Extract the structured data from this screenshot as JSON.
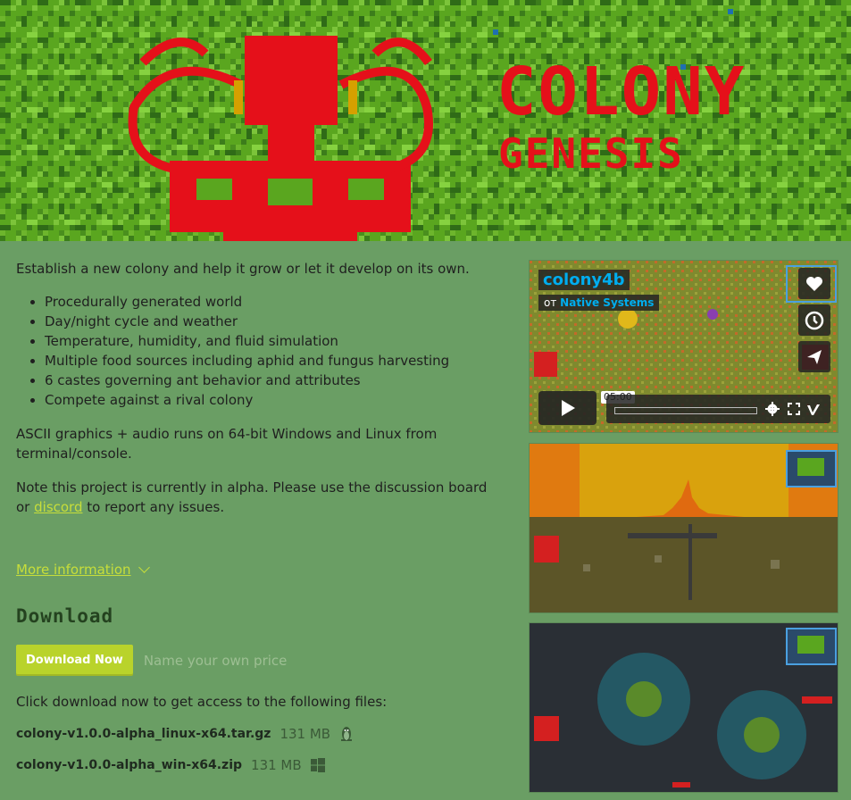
{
  "banner": {
    "title_line1": "COLONY",
    "title_line2": "GENESIS",
    "colors": {
      "grass": "#5aa61f",
      "grass_dark": "#3c7d1b",
      "ant": "#e5101a",
      "accent": "#d6a000"
    }
  },
  "description": {
    "intro": "Establish a new colony and help it grow or let it develop on its own.",
    "features": [
      "Procedurally generated world",
      "Day/night cycle and weather",
      "Temperature, humidity, and fluid simulation",
      "Multiple food sources including aphid and fungus harvesting",
      "6 castes governing ant behavior and attributes",
      "Compete against a rival colony"
    ],
    "platforms": "ASCII graphics + audio runs on 64-bit Windows and Linux from terminal/console.",
    "alpha_note_before": "Note this project is currently in alpha. Please use the discussion board or ",
    "alpha_note_link": "discord",
    "alpha_note_after": " to report any issues.",
    "more_info": "More information"
  },
  "download": {
    "heading": "Download",
    "button_label": "Download Now",
    "price_hint": "Name your own price",
    "files_intro": "Click download now to get access to the following files:",
    "files": [
      {
        "name": "colony-v1.0.0-alpha_linux-x64.tar.gz",
        "size": "131 MB",
        "platform_icon": "linux-icon"
      },
      {
        "name": "colony-v1.0.0-alpha_win-x64.zip",
        "size": "131 MB",
        "platform_icon": "windows-icon"
      }
    ]
  },
  "video": {
    "title": "colony4b",
    "by_prefix": "от",
    "author": "Native Systems",
    "duration": "05:00",
    "side_icons": [
      "heart-icon",
      "clock-icon",
      "send-icon"
    ],
    "controls": [
      "settings-icon",
      "fullscreen-icon",
      "vimeo-icon"
    ]
  },
  "theme": {
    "link_color": "#c7de3a",
    "button_color": "#b9d32b",
    "page_bg": "#6a9e64"
  }
}
